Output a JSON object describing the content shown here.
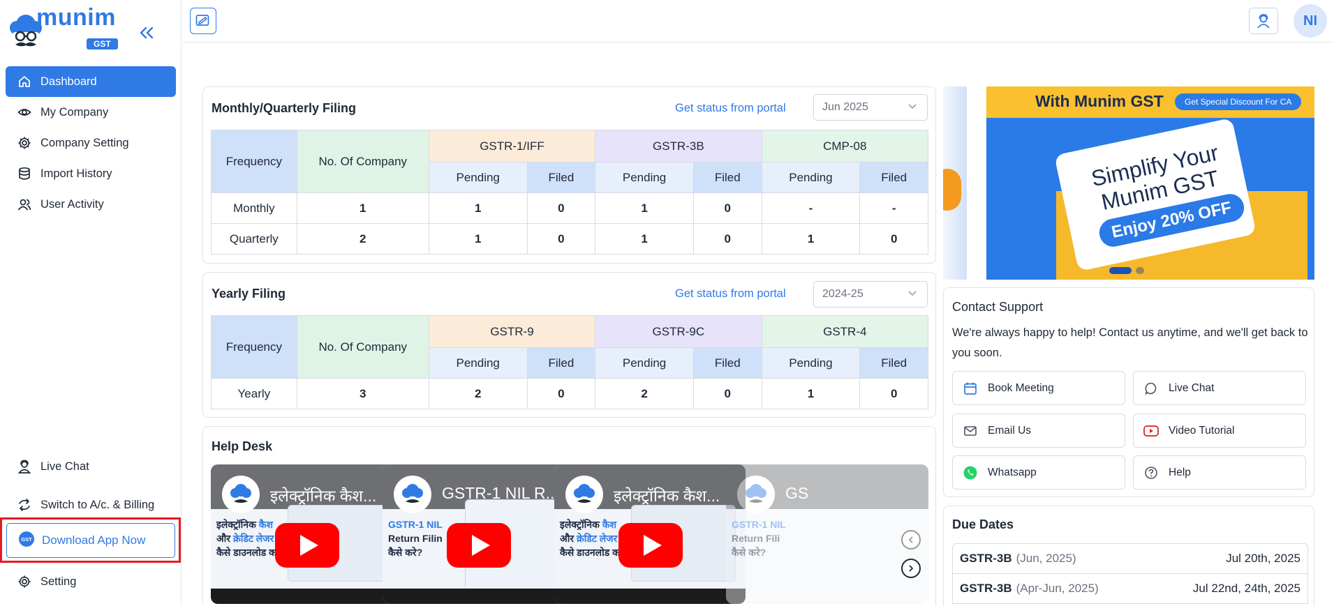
{
  "brand": {
    "name": "munim",
    "badge": "GST"
  },
  "sidebar": {
    "items": [
      {
        "label": "Dashboard",
        "icon": "home-icon",
        "active": true
      },
      {
        "label": "My Company",
        "icon": "eye-icon"
      },
      {
        "label": "Company Setting",
        "icon": "gear-icon"
      },
      {
        "label": "Import History",
        "icon": "database-icon"
      },
      {
        "label": "User Activity",
        "icon": "users-icon"
      }
    ],
    "bottom": {
      "live_chat": "Live Chat",
      "switch": "Switch to A/c. & Billing",
      "download": "Download App Now",
      "setting": "Setting"
    }
  },
  "topbar": {
    "avatar_initials": "NI"
  },
  "monthly": {
    "title": "Monthly/Quarterly Filing",
    "portal_link": "Get status from portal",
    "period": "Jun 2025",
    "headers": {
      "frequency": "Frequency",
      "companies": "No. Of Company",
      "g1": "GSTR-1/IFF",
      "g2": "GSTR-3B",
      "g3": "CMP-08",
      "pending": "Pending",
      "filed": "Filed"
    },
    "rows": [
      {
        "freq": "Monthly",
        "count": "1",
        "v": [
          "1",
          "0",
          "1",
          "0",
          "-",
          "-"
        ]
      },
      {
        "freq": "Quarterly",
        "count": "2",
        "v": [
          "1",
          "0",
          "1",
          "0",
          "1",
          "0"
        ]
      }
    ]
  },
  "yearly": {
    "title": "Yearly Filing",
    "portal_link": "Get status from portal",
    "period": "2024-25",
    "headers": {
      "frequency": "Frequency",
      "companies": "No. Of Company",
      "g1": "GSTR-9",
      "g2": "GSTR-9C",
      "g3": "GSTR-4",
      "pending": "Pending",
      "filed": "Filed"
    },
    "rows": [
      {
        "freq": "Yearly",
        "count": "3",
        "v": [
          "2",
          "0",
          "2",
          "0",
          "1",
          "0"
        ]
      }
    ]
  },
  "helpdesk": {
    "title": "Help Desk",
    "videos": [
      {
        "title": "इलेक्ट्रॉनिक कैश...",
        "line1a": "इलेक्ट्रॉनिक ",
        "line1b": "कैश",
        "line2a": "और ",
        "line2b": "क्रेडिट लेजर",
        "line3": "कैसे डाउनलोड क"
      },
      {
        "title": "GSTR-1 NIL R...",
        "line1a": "",
        "line1b": "GSTR-1 NIL",
        "line2a": "Return Filin",
        "line2b": "",
        "line3": "कैसे करे?"
      },
      {
        "title": "इलेक्ट्रॉनिक कैश...",
        "line1a": "इलेक्ट्रॉनिक ",
        "line1b": "कैश",
        "line2a": "और ",
        "line2b": "क्रेडिट लेजर",
        "line3": "कैसे डाउनलोड क"
      },
      {
        "title": "GS",
        "line1a": "",
        "line1b": "GSTR-1 NIL",
        "line2a": "Return Fili",
        "line2b": "",
        "line3": "कैसे करे?"
      }
    ]
  },
  "banner": {
    "heading": "With Munim GST",
    "pill": "Get Special Discount For CA",
    "line1": "Simplify Your",
    "line2": "Munim GST",
    "offer": "Enjoy 20% OFF"
  },
  "support": {
    "title": "Contact Support",
    "text": "We're always happy to help! Contact us anytime, and we'll get back to you soon.",
    "buttons": [
      "Book Meeting",
      "Live Chat",
      "Email Us",
      "Video Tutorial",
      "Whatsapp",
      "Help"
    ]
  },
  "due_dates": {
    "title": "Due Dates",
    "rows": [
      {
        "name": "GSTR-3B",
        "period": "(Jun, 2025)",
        "date": "Jul 20th, 2025"
      },
      {
        "name": "GSTR-3B",
        "period": "(Apr-Jun, 2025)",
        "date": "Jul 22nd, 24th, 2025"
      }
    ]
  },
  "colors": {
    "accent": "#2f7ae5",
    "highlight_border": "#e51b23",
    "youtube_red": "#ff0000"
  }
}
